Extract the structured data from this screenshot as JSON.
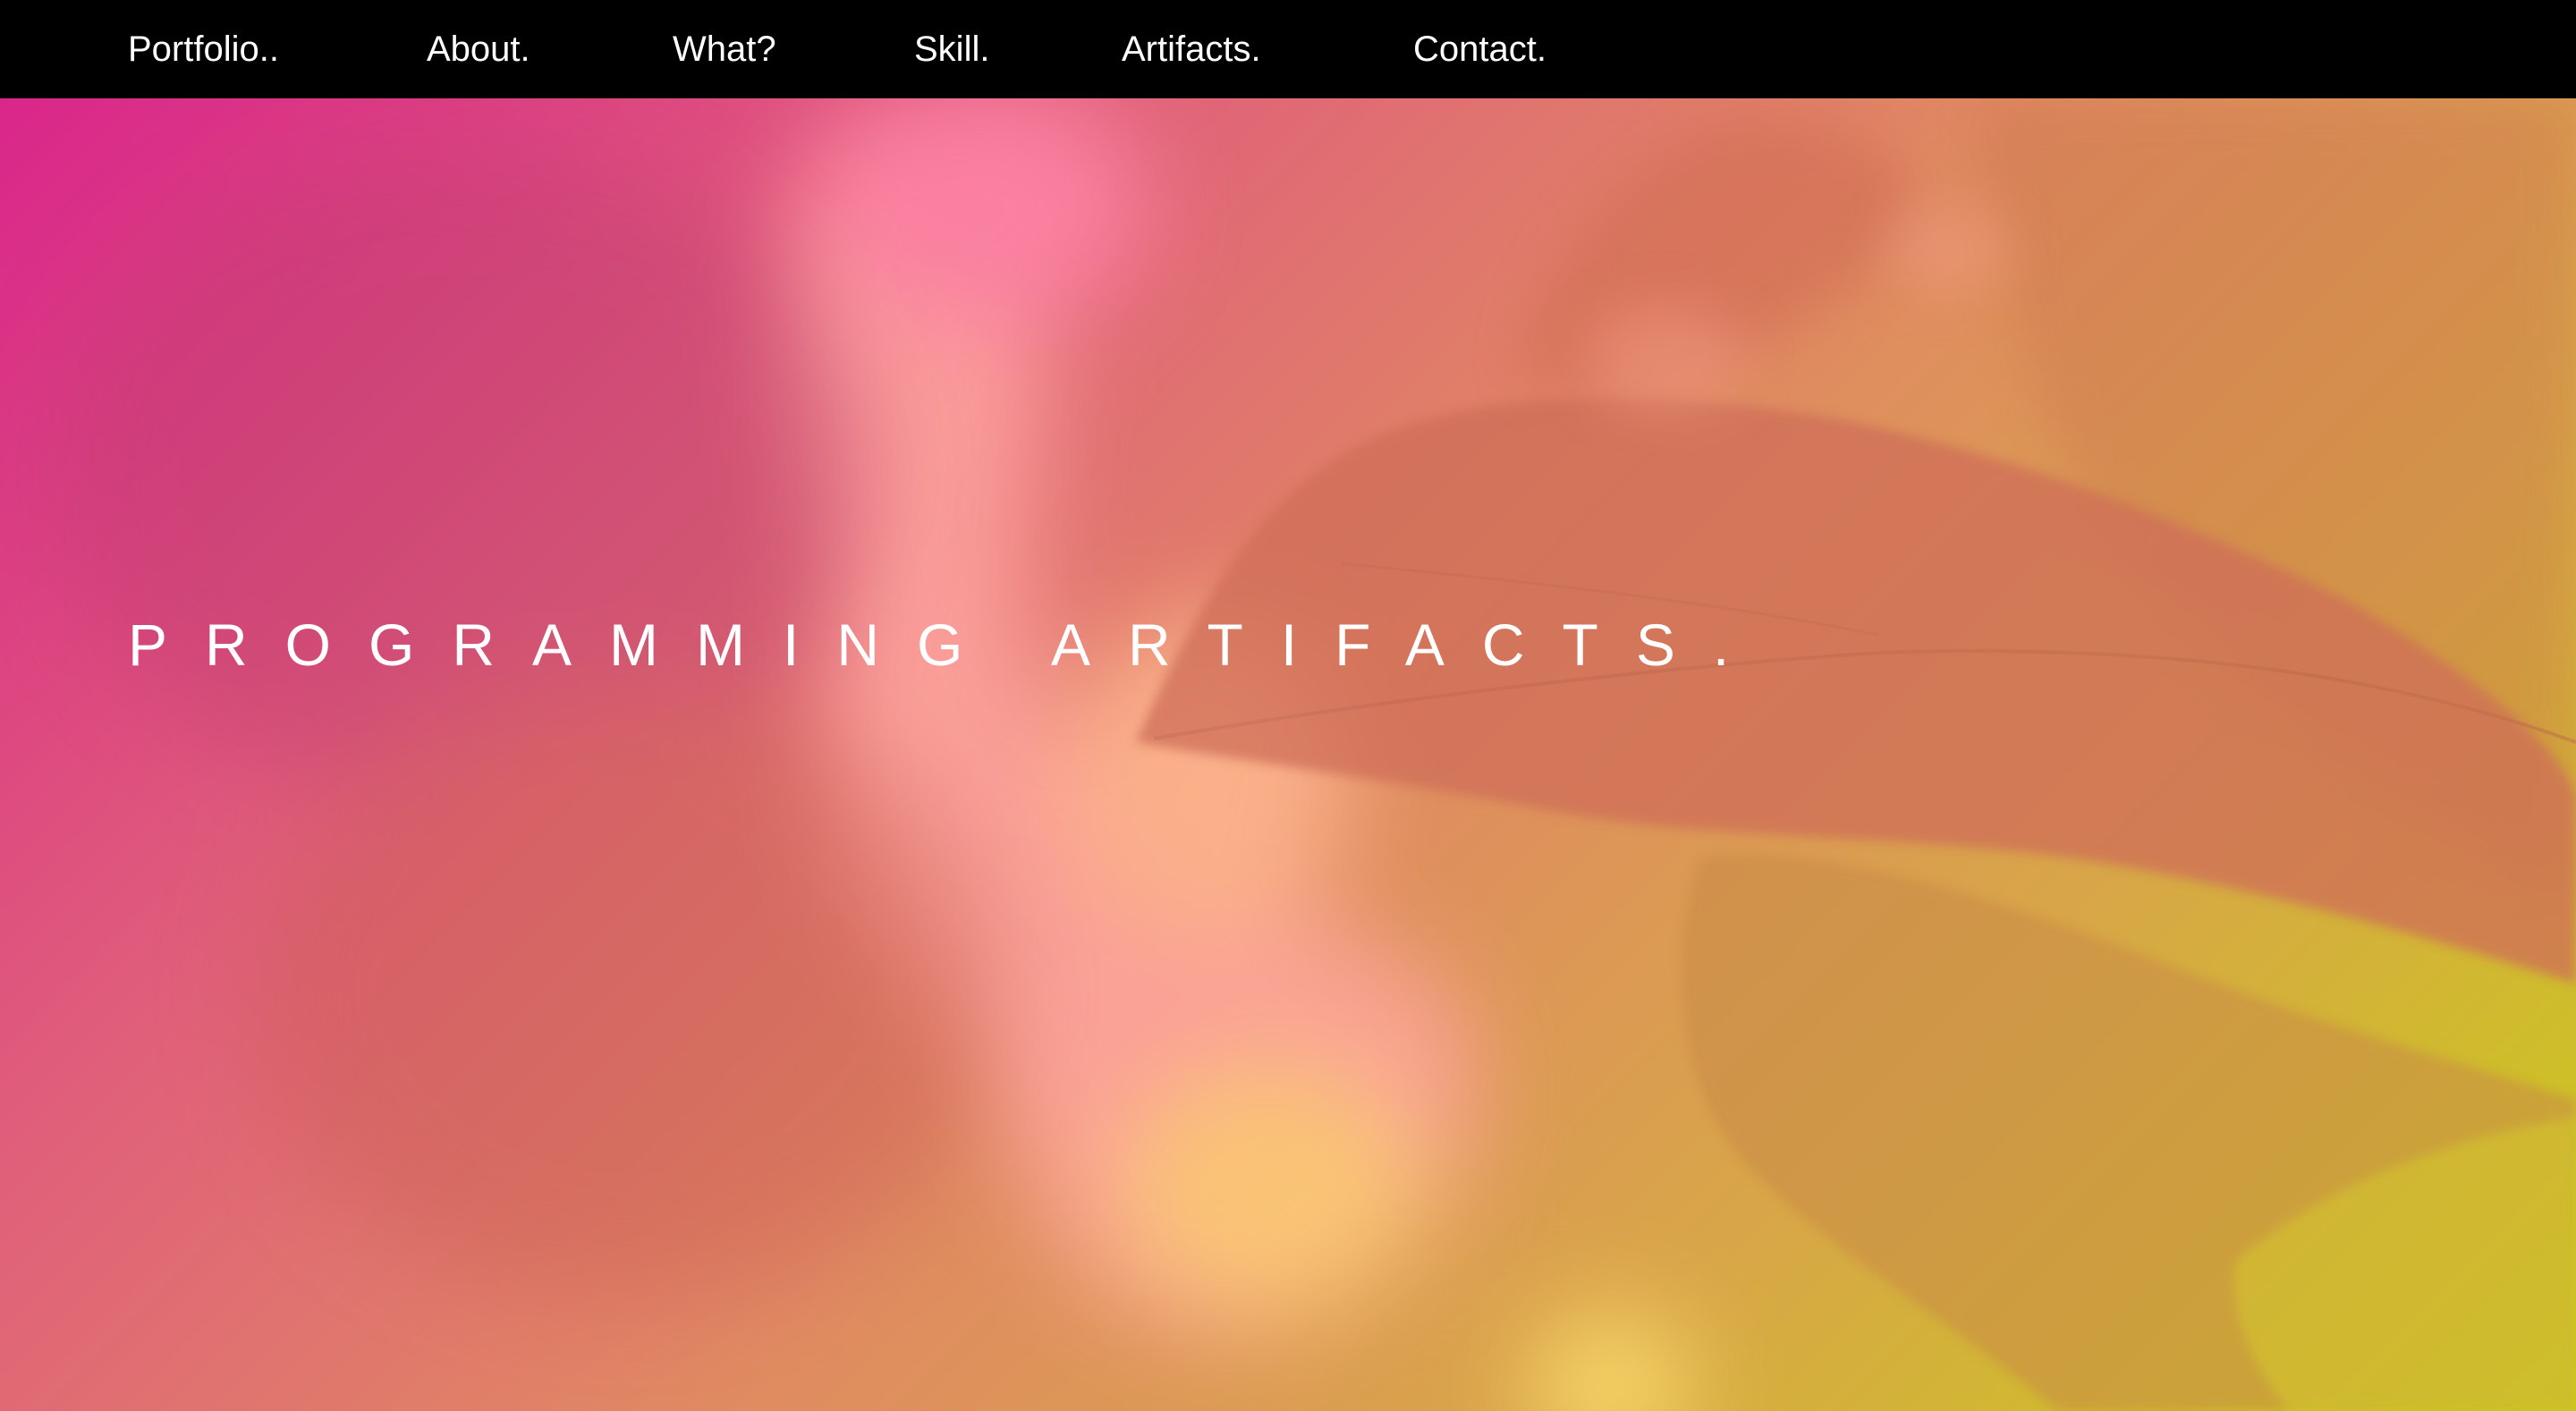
{
  "nav": {
    "items": [
      {
        "label": "Portfolio.."
      },
      {
        "label": "About."
      },
      {
        "label": "What?"
      },
      {
        "label": "Skill."
      },
      {
        "label": "Artifacts."
      },
      {
        "label": "Contact."
      }
    ]
  },
  "hero": {
    "headline": "PROGRAMMING ARTIFACTS.",
    "colors": {
      "gradient_start": "#d9268a",
      "gradient_mid": "#e08a62",
      "gradient_end": "#c9cc18"
    }
  }
}
